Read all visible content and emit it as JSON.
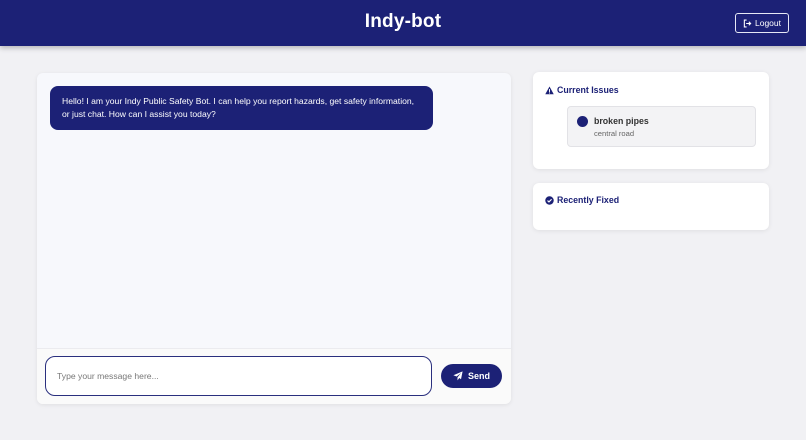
{
  "header": {
    "title": "Indy-bot",
    "logout_label": "Logout"
  },
  "chat": {
    "messages": [
      {
        "sender": "bot",
        "text": "Hello! I am your Indy Public Safety Bot. I can help you report hazards, get safety information, or just chat. How can I assist you today?"
      }
    ],
    "input": {
      "value": "",
      "placeholder": "Type your message here..."
    },
    "send_label": "Send"
  },
  "sidebar": {
    "current_issues": {
      "title": "Current Issues",
      "icon": "warning-triangle-icon",
      "items": [
        {
          "title": "broken pipes",
          "location": "central road"
        }
      ]
    },
    "recently_fixed": {
      "title": "Recently Fixed",
      "icon": "check-circle-icon",
      "items": []
    }
  },
  "colors": {
    "primary": "#1c2176",
    "background": "#f1f1f4",
    "panel": "#f7f8fc",
    "card": "#ffffff"
  }
}
